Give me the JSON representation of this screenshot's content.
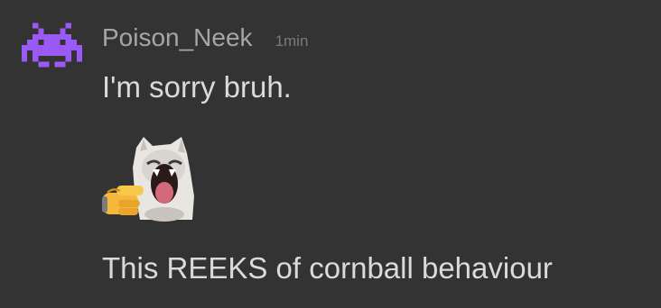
{
  "message": {
    "author": "Poison_Neek",
    "timestamp": "1min",
    "text_before": "I'm sorry bruh.",
    "emoji": "pointing-laughing-cat-emoji",
    "text_after": "This REEKS of cornball behaviour"
  },
  "avatar": {
    "icon": "space-invader-icon",
    "color": "#9b59f5"
  },
  "colors": {
    "background": "#333333",
    "author": "#a6a6a6",
    "timestamp": "#7a7a7a",
    "text": "#dadada"
  }
}
